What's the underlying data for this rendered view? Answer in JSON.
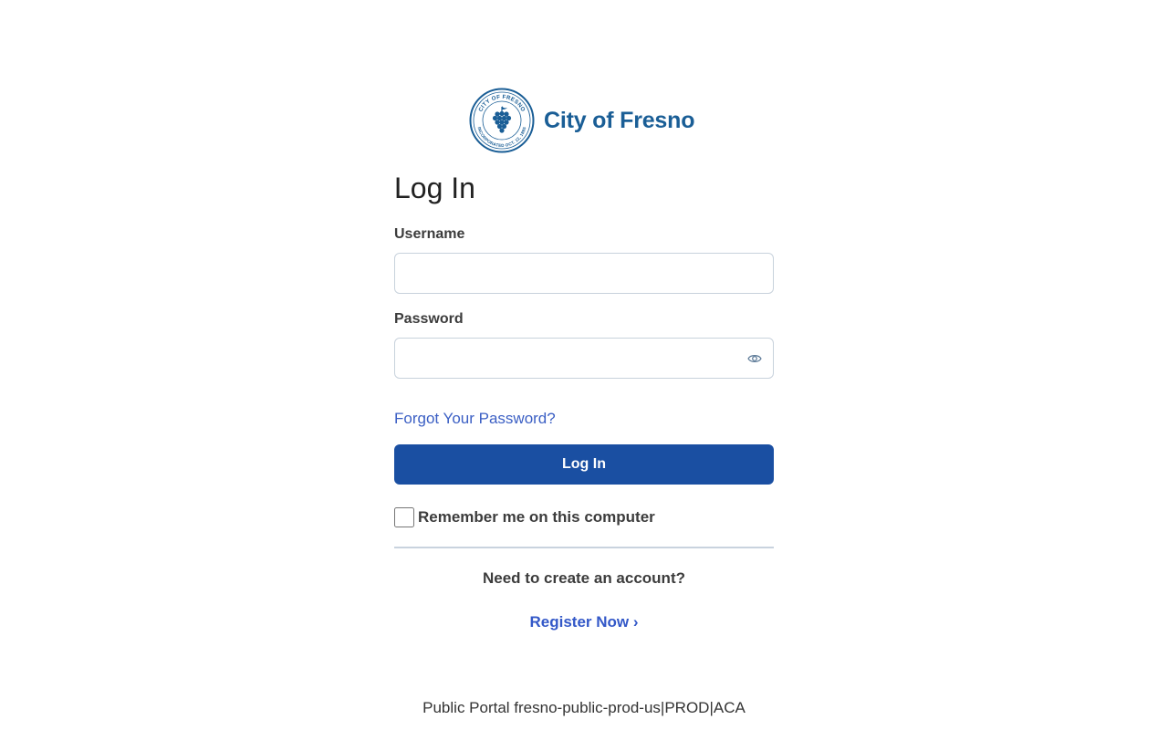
{
  "logo": {
    "seal_text_top": "CITY OF FRESNO",
    "seal_text_bottom": "INCORPORATED OCT. 12, 1885",
    "name": "City of Fresno",
    "brand_color": "#1a5e96"
  },
  "form": {
    "title": "Log In",
    "username_label": "Username",
    "username_value": "",
    "password_label": "Password",
    "password_value": "",
    "forgot_link": "Forgot Your Password?",
    "login_button": "Log In",
    "remember_label": "Remember me on this computer",
    "remember_checked": false,
    "need_account": "Need to create an account?",
    "register_link": "Register Now ›"
  },
  "footer": {
    "text": "Public Portal fresno-public-prod-us|PROD|ACA"
  },
  "colors": {
    "primary_button": "#1a4fa2",
    "link": "#3b5fc4"
  },
  "icons": {
    "password_toggle": "eye-icon",
    "seal_emblem": "grapes-icon"
  }
}
